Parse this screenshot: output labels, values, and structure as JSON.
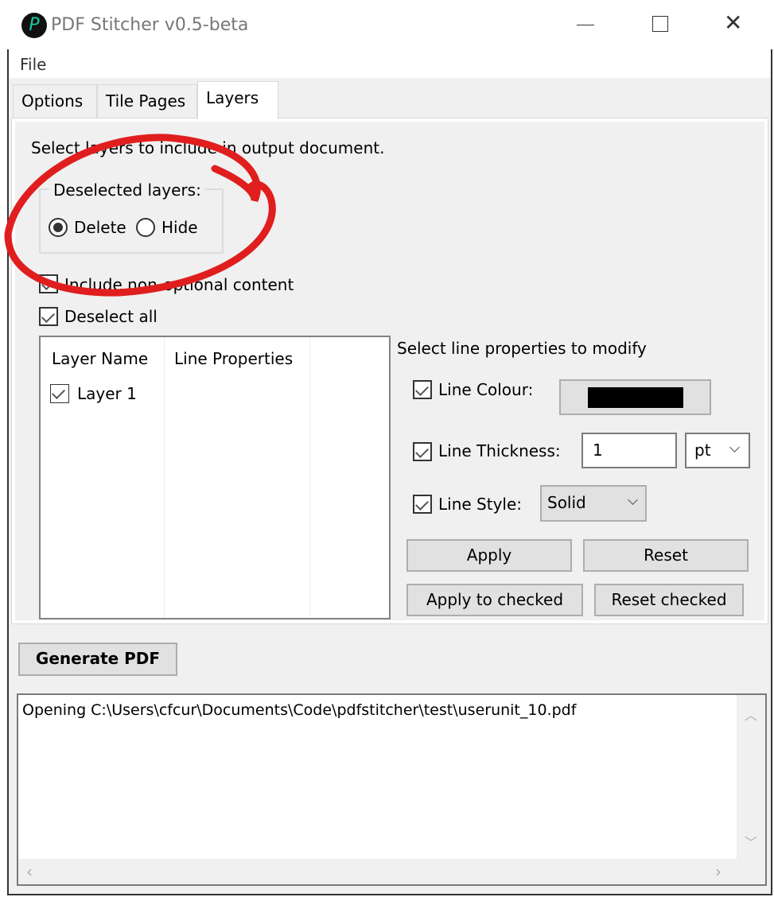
{
  "window": {
    "title": "PDF Stitcher v0.5-beta",
    "minimize_icon": "minimize-icon",
    "maximize_icon": "maximize-icon",
    "close_icon": "close-icon"
  },
  "menu": {
    "file": "File"
  },
  "tabs": [
    {
      "label": "Options",
      "active": false
    },
    {
      "label": "Tile Pages",
      "active": false
    },
    {
      "label": "Layers",
      "active": true
    }
  ],
  "layers": {
    "instruction": "Select layers to include in output document.",
    "deselected_group": {
      "label": "Deselected layers:",
      "options": [
        {
          "label": "Delete",
          "selected": true
        },
        {
          "label": "Hide",
          "selected": false
        }
      ]
    },
    "include_non_optional": {
      "label": "Include non-optional content",
      "checked": true
    },
    "deselect_all": {
      "label": "Deselect all",
      "checked": true
    },
    "table": {
      "columns": [
        "Layer Name",
        "Line Properties"
      ],
      "rows": [
        {
          "name": "Layer 1",
          "checked": true,
          "properties": ""
        }
      ]
    },
    "line_props": {
      "heading": "Select line properties to modify",
      "colour": {
        "label": "Line Colour:",
        "checked": true,
        "value": "#000000"
      },
      "thickness": {
        "label": "Line Thickness:",
        "checked": true,
        "value": "1",
        "unit": "pt"
      },
      "style": {
        "label": "Line Style:",
        "checked": true,
        "value": "Solid"
      },
      "apply": "Apply",
      "reset": "Reset",
      "apply_checked": "Apply to checked",
      "reset_checked": "Reset checked"
    }
  },
  "generate": "Generate PDF",
  "log": {
    "text": "Opening C:\\Users\\cfcur\\Documents\\Code\\pdfstitcher\\test\\userunit_10.pdf"
  },
  "annotation": {
    "color": "#e01e1e"
  }
}
